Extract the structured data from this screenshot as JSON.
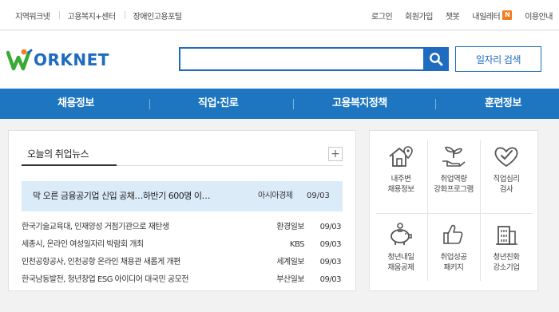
{
  "topbar": {
    "left_links": [
      "지역워크넷",
      "고용복지+센터",
      "장애인고용포털"
    ],
    "right_links": [
      "로그인",
      "회원가입",
      "챗봇",
      "내일레터",
      "이용안내"
    ],
    "naeil_badge": "N"
  },
  "header": {
    "logo_text": "ORKNET",
    "search_placeholder": "",
    "job_search_label": "일자리 검색"
  },
  "gnb": [
    "채용정보",
    "직업·진로",
    "고용복지정책",
    "훈련정보"
  ],
  "news": {
    "title": "오늘의 취업뉴스",
    "more": "+",
    "headline": {
      "title": "막 오른 금융공기업 신입 공채…하반기 600명 이…",
      "source": "아시아경제",
      "date": "09/03"
    },
    "items": [
      {
        "title": "한국기술교육대, 인재양성 거점기관으로 재탄생",
        "source": "환경일보",
        "date": "09/03"
      },
      {
        "title": "세종시, 온라인 여성일자리 박람회 개최",
        "source": "KBS",
        "date": "09/03"
      },
      {
        "title": "인천공항공사, 인천공항 온라인 채용관 새롭게 개편",
        "source": "세계일보",
        "date": "09/03"
      },
      {
        "title": "한국남동발전, 청년창업 ESG 아이디어 대국민 공모전",
        "source": "부산일보",
        "date": "09/03"
      }
    ]
  },
  "services": [
    {
      "icon": "house-location-icon",
      "line1": "내주변",
      "line2": "채용정보"
    },
    {
      "icon": "sprout-hand-icon",
      "line1": "취업역량",
      "line2": "강화프로그램"
    },
    {
      "icon": "heart-check-icon",
      "line1": "직업심리",
      "line2": "검사"
    },
    {
      "icon": "piggy-bank-icon",
      "line1": "청년내일",
      "line2": "채움공제"
    },
    {
      "icon": "thumbs-up-icon",
      "line1": "취업성공",
      "line2": "패키지"
    },
    {
      "icon": "building-icon",
      "line1": "청년친화",
      "line2": "강소기업"
    }
  ],
  "colors": {
    "brand_blue": "#1e76c0",
    "logo_green": "#3aaa35",
    "badge_orange": "#f47c20",
    "headline_bg": "#dcebf8"
  }
}
